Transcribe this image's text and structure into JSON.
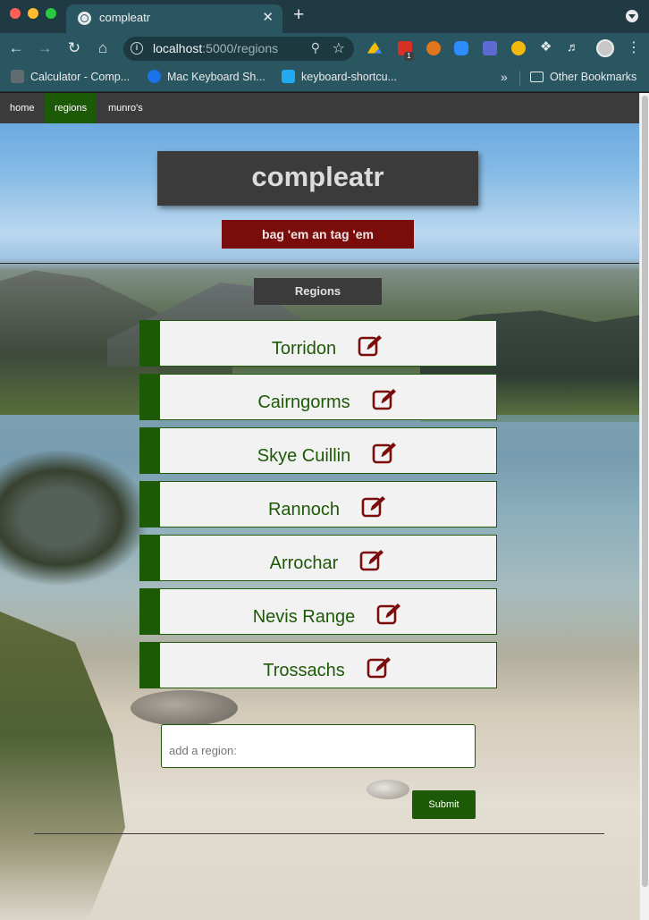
{
  "browser": {
    "tab_title": "compleatr",
    "tab_close": "✕",
    "new_tab": "+",
    "url_host": "localhost",
    "url_rest": ":5000/regions",
    "cal_badge": "1",
    "bookmarks": [
      "Calculator - Comp...",
      "Mac Keyboard Sh...",
      "keyboard-shortcu..."
    ],
    "bookmarks_more": "»",
    "other_bookmarks": "Other Bookmarks"
  },
  "nav": {
    "home": "home",
    "regions": "regions",
    "munros": "munro's",
    "active": "regions"
  },
  "site": {
    "title": "compleatr",
    "tagline": "bag 'em an tag 'em",
    "section_label": "Regions"
  },
  "regions": [
    {
      "name": "Torridon",
      "icon": "edit-icon"
    },
    {
      "name": "Cairngorms",
      "icon": "edit-icon"
    },
    {
      "name": "Skye Cuillin",
      "icon": "edit-icon"
    },
    {
      "name": "Rannoch",
      "icon": "edit-icon"
    },
    {
      "name": "Arrochar",
      "icon": "edit-icon"
    },
    {
      "name": "Nevis Range",
      "icon": "edit-icon"
    },
    {
      "name": "Trossachs",
      "icon": "edit-icon"
    }
  ],
  "add_form": {
    "placeholder": "add a region:",
    "value": "",
    "submit_label": "Submit"
  },
  "colors": {
    "brand_green": "#1d5a07",
    "brand_red": "#7a0c0c",
    "panel_dark": "#3b3b3b",
    "row_bg": "#f2f2f2",
    "edit_icon": "#7a0c0c"
  }
}
